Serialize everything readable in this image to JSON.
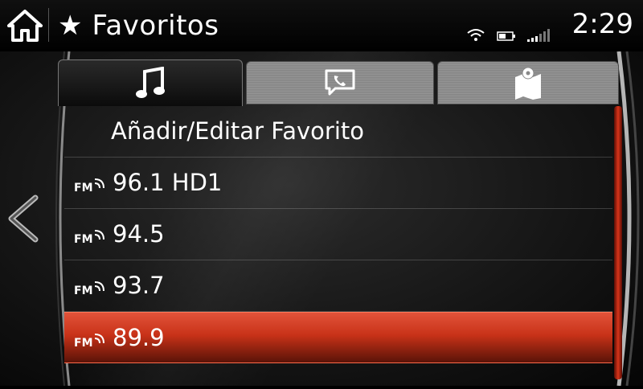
{
  "header": {
    "home_icon": "home-icon",
    "star_icon": "star-icon",
    "title": "Favoritos",
    "status_icons": [
      "wifi-icon",
      "battery-icon",
      "signal-icon"
    ],
    "clock": "2:29"
  },
  "tabs": [
    {
      "icon": "music-note-icon",
      "active": true
    },
    {
      "icon": "phone-message-icon",
      "active": false
    },
    {
      "icon": "map-pin-icon",
      "active": false
    }
  ],
  "list": {
    "add_edit_label": "Añadir/Editar Favorito",
    "items": [
      {
        "band": "FM",
        "label": "96.1 HD1",
        "selected": false
      },
      {
        "band": "FM",
        "label": "94.5",
        "selected": false
      },
      {
        "band": "FM",
        "label": "93.7",
        "selected": false
      },
      {
        "band": "FM",
        "label": "89.9",
        "selected": true
      }
    ]
  },
  "colors": {
    "accent": "#d8351a",
    "background": "#000000",
    "text": "#ffffff"
  }
}
